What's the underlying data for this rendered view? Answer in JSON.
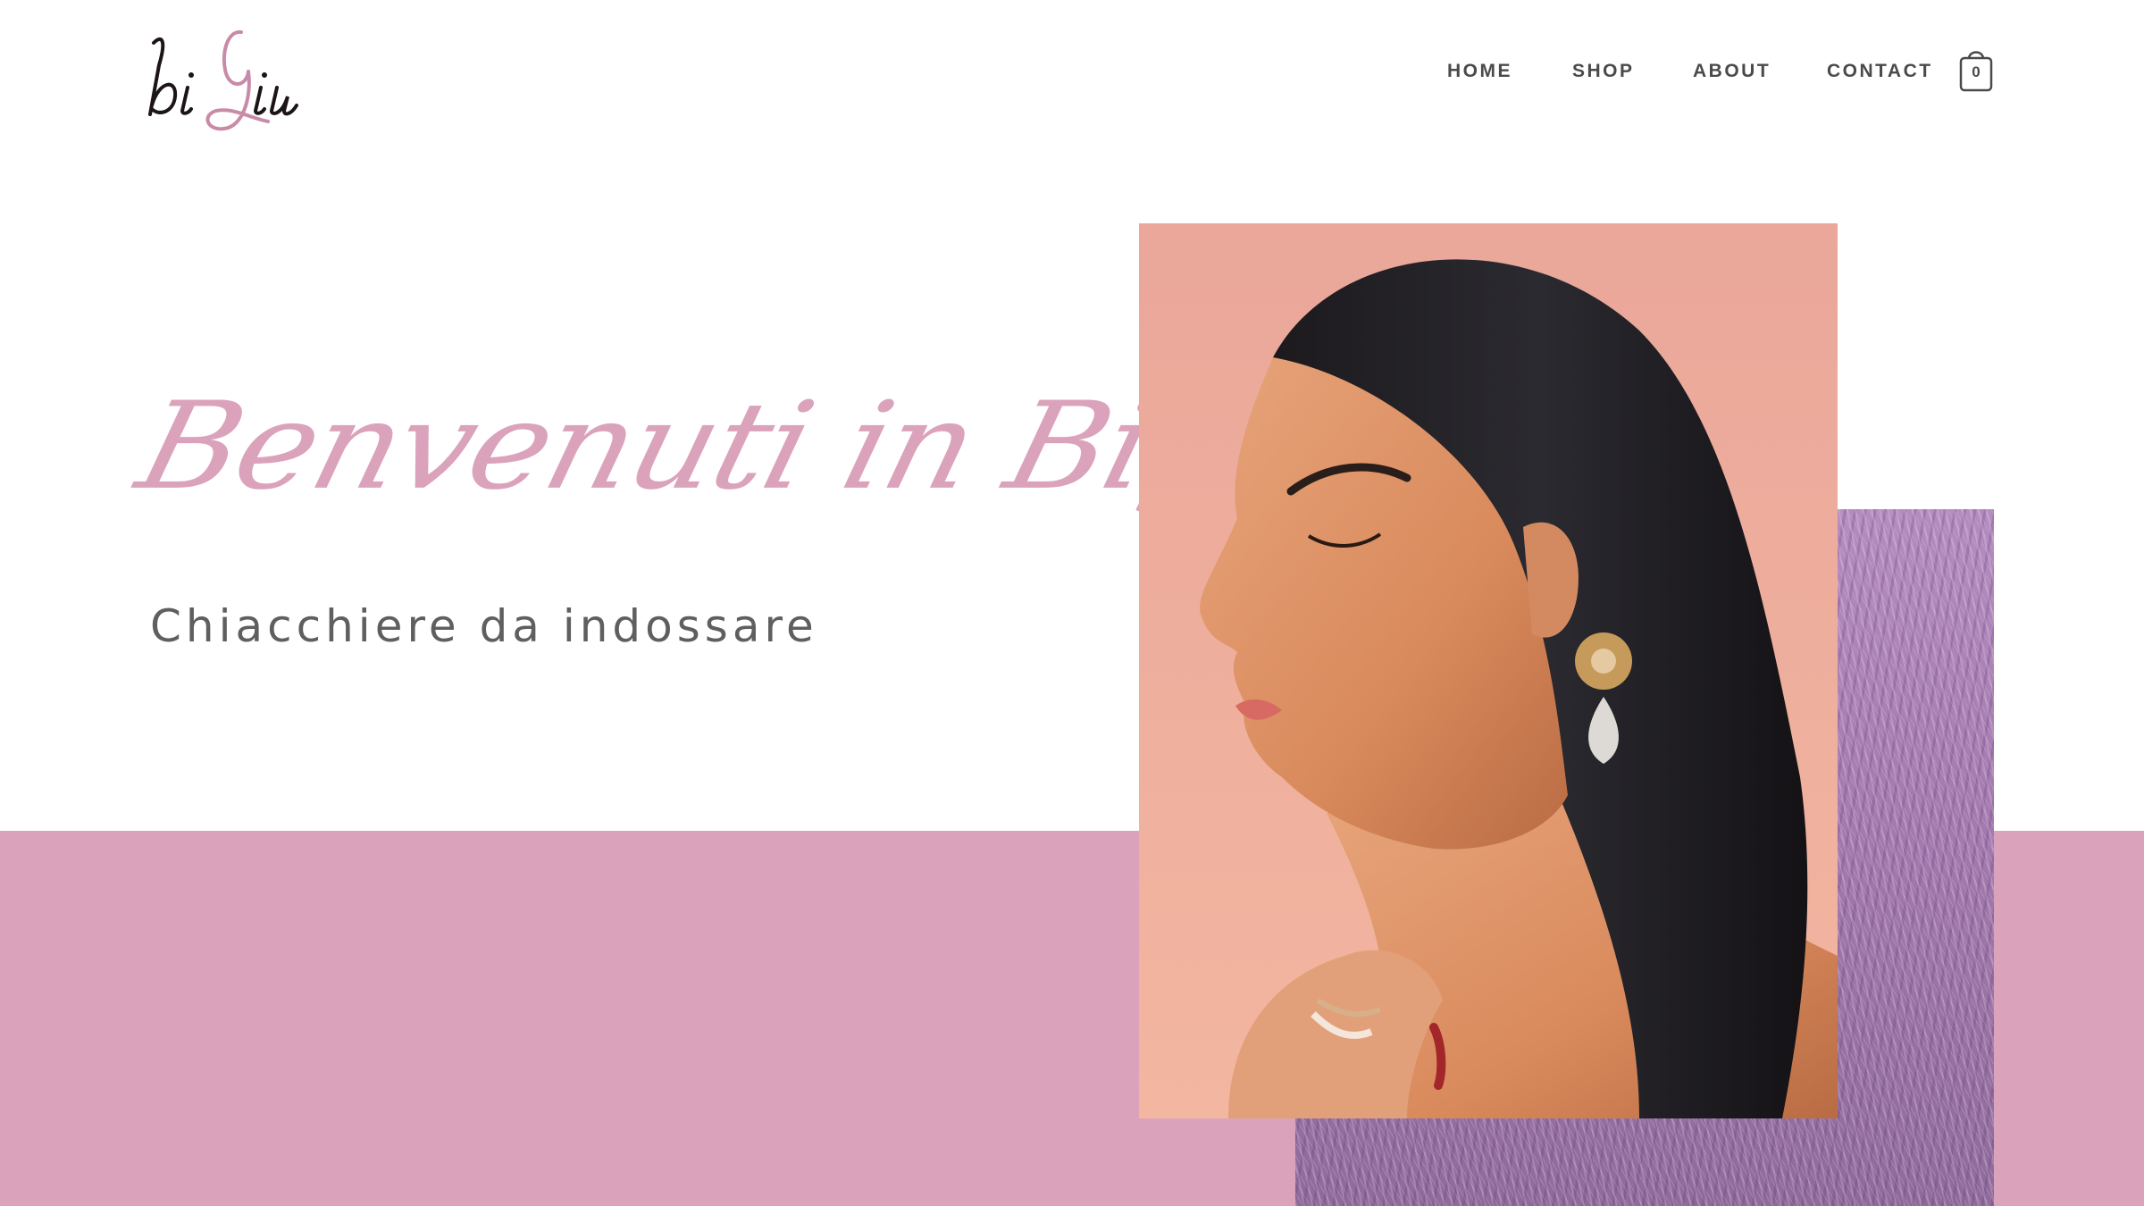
{
  "brand": {
    "logo_text": "biGiu",
    "icon": "brand-logo"
  },
  "nav": {
    "items": [
      {
        "label": "HOME"
      },
      {
        "label": "SHOP"
      },
      {
        "label": "ABOUT"
      },
      {
        "label": "CONTACT"
      }
    ],
    "cart": {
      "icon": "shopping-bag-icon",
      "count": "0"
    }
  },
  "hero": {
    "title": "Benvenuti in Bigiu",
    "subtitle": "Chiacchiere da indossare"
  },
  "colors": {
    "accent_pink": "#dba3bb",
    "text_dark": "#4a4a4a",
    "text_gray": "#5f5f5f",
    "background": "#ffffff"
  }
}
